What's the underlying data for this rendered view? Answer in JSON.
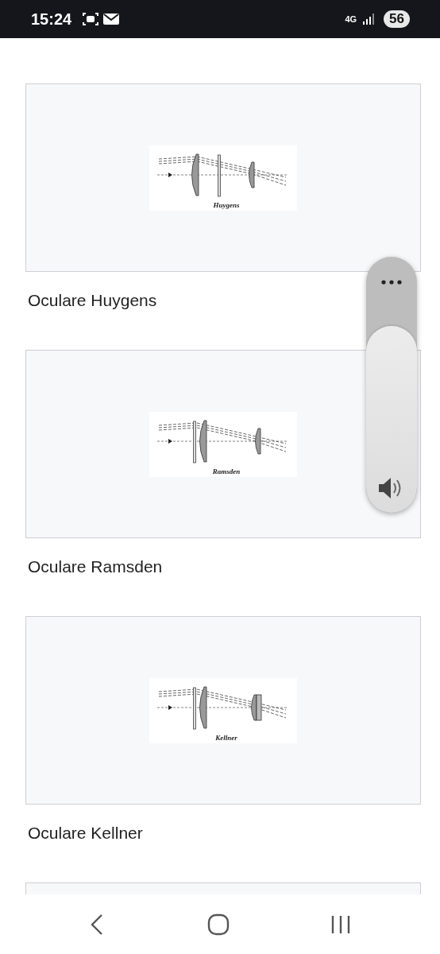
{
  "status_bar": {
    "time": "15:24",
    "network": "4G",
    "battery": "56"
  },
  "cards": [
    {
      "diagram": {
        "kind": "huygens",
        "caption": "Huygens"
      },
      "title": "Oculare Huygens"
    },
    {
      "diagram": {
        "kind": "ramsden",
        "caption": "Ramsden"
      },
      "title": "Oculare Ramsden"
    },
    {
      "diagram": {
        "kind": "kellner",
        "caption": "Kellner"
      },
      "title": "Oculare Kellner"
    }
  ],
  "next_card_visible": true,
  "volume_panel": {
    "level": 0.73
  }
}
